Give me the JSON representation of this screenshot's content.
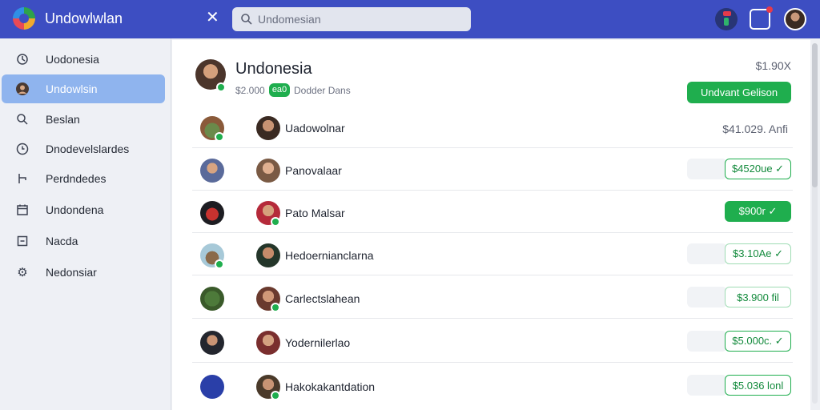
{
  "app": {
    "title": "Undowlwlan"
  },
  "search": {
    "placeholder": "Undomesian"
  },
  "sidebar": {
    "items": [
      {
        "label": "Uodonesia",
        "icon": "refresh-icon"
      },
      {
        "label": "Undowlsin",
        "icon": "person-icon",
        "active": true
      },
      {
        "label": "Beslan",
        "icon": "search-icon"
      },
      {
        "label": "Dnodevelslardes",
        "icon": "clock-icon"
      },
      {
        "label": "Perdndedes",
        "icon": "branch-icon"
      },
      {
        "label": "Undondena",
        "icon": "calendar-icon"
      },
      {
        "label": "Nacda",
        "icon": "square-icon"
      },
      {
        "label": "Nedonsiar",
        "icon": "gear-icon"
      }
    ]
  },
  "header": {
    "title": "Undonesia",
    "amount": "$1.90X",
    "sub_amount": "$2.000",
    "pill": "ea0",
    "sub_text": "Dodder Dans",
    "action_label": "Undvant Gelison"
  },
  "rows": [
    {
      "name": "Uadowolnar",
      "amount": "$41.029. Anfi",
      "style": "plain"
    },
    {
      "name": "Panovalaar",
      "amount": "$4520ue ✓",
      "style": "outline"
    },
    {
      "name": "Pato Malsar",
      "amount": "$900r ✓",
      "style": "filled"
    },
    {
      "name": "Hedoernianclarna",
      "amount": "$3.10Ae ✓",
      "style": "light"
    },
    {
      "name": "Carlectslahean",
      "amount": "$3.900 fil",
      "style": "light"
    },
    {
      "name": "Yodernilerlao",
      "amount": "$5.000c. ✓",
      "style": "outline"
    },
    {
      "name": "Hakokakantdation",
      "amount": "$5.036 lonl",
      "style": "outline"
    }
  ],
  "colors": {
    "topbar": "#3d4ec2",
    "accent_green": "#1fae4e",
    "active_nav": "#8fb4ee"
  }
}
